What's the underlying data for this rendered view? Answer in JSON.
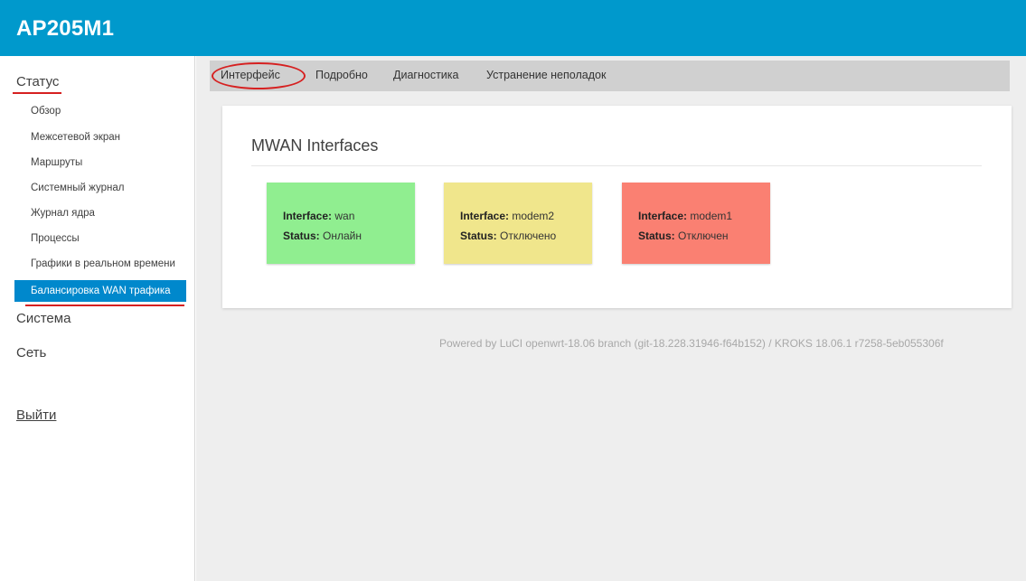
{
  "header": {
    "title": "AP205M1"
  },
  "sidebar": {
    "status": "Статус",
    "sub_items": [
      "Обзор",
      "Межсетевой экран",
      "Маршруты",
      "Системный журнал",
      "Журнал ядра",
      "Процессы",
      "Графики в реальном времени"
    ],
    "active_item": "Балансировка WAN трафика",
    "system": "Система",
    "network": "Сеть",
    "logout": "Выйти"
  },
  "tabs": [
    "Интерфейс",
    "Подробно",
    "Диагностика",
    "Устранение неполадок"
  ],
  "panel": {
    "title": "MWAN Interfaces",
    "interface_label": "Interface:",
    "status_label": "Status:",
    "cards": [
      {
        "interface": "wan",
        "status": "Онлайн",
        "color": "#90ee90"
      },
      {
        "interface": "modem2",
        "status": "Отключено",
        "color": "#f0e68c"
      },
      {
        "interface": "modem1",
        "status": "Отключен",
        "color": "#fa8072"
      }
    ]
  },
  "footer": "Powered by LuCI openwrt-18.06 branch (git-18.228.31946-f64b152) / KROKS 18.06.1 r7258-5eb055306f",
  "colors": {
    "header_bg": "#0099cc",
    "active_item_bg": "#0088cc",
    "annotation_red": "#d62020"
  }
}
